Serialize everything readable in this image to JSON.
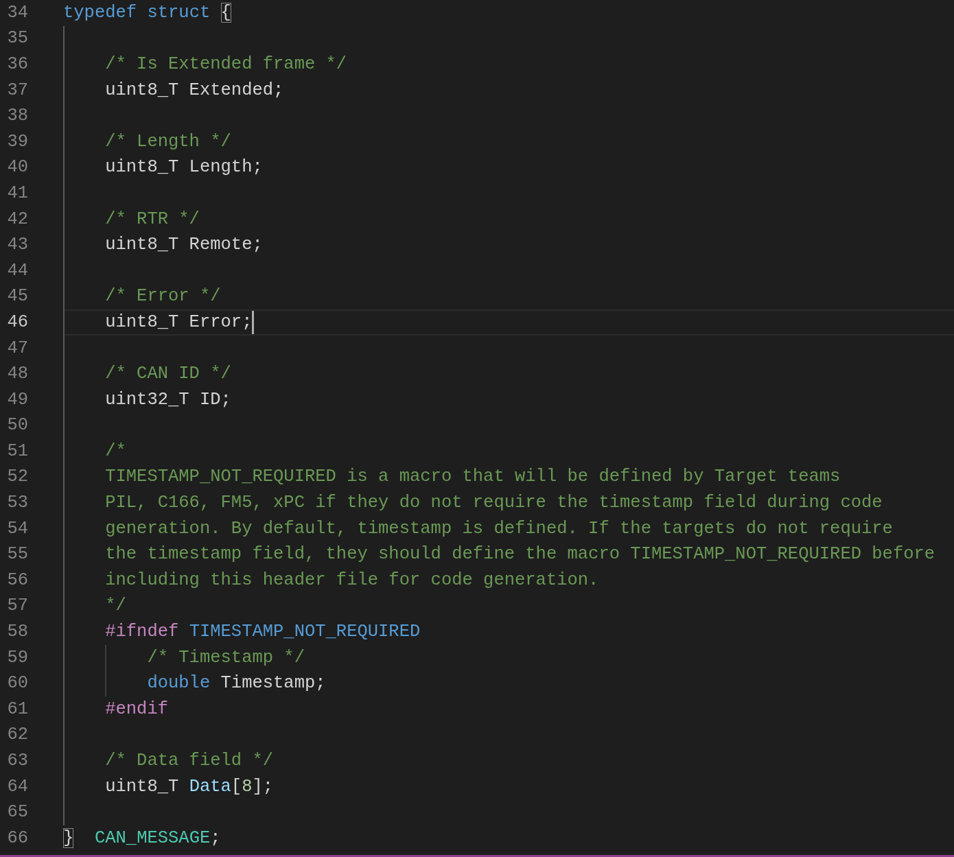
{
  "editor": {
    "lines": [
      {
        "number": "34",
        "current": false,
        "tokens": [
          {
            "text": "typedef struct ",
            "kind": "keyword"
          },
          {
            "text": "{",
            "kind": "bracket-match"
          }
        ],
        "children": [
          {
            "number": "35",
            "current": false
          },
          {
            "number": "36",
            "current": false,
            "tokens": [
              {
                "text": "/* Is Extended frame */",
                "kind": "comment"
              }
            ]
          },
          {
            "number": "37",
            "current": false,
            "tokens": [
              {
                "text": "uint8_T Extended;",
                "kind": "text"
              }
            ]
          },
          {
            "number": "38",
            "current": false
          },
          {
            "number": "39",
            "current": false,
            "tokens": [
              {
                "text": "/* Length */",
                "kind": "comment"
              }
            ]
          },
          {
            "number": "40",
            "current": false,
            "tokens": [
              {
                "text": "uint8_T Length;",
                "kind": "text"
              }
            ]
          },
          {
            "number": "41",
            "current": false
          },
          {
            "number": "42",
            "current": false,
            "tokens": [
              {
                "text": "/* RTR */",
                "kind": "comment"
              }
            ]
          },
          {
            "number": "43",
            "current": false,
            "tokens": [
              {
                "text": "uint8_T Remote;",
                "kind": "text"
              }
            ]
          },
          {
            "number": "44",
            "current": false
          },
          {
            "number": "45",
            "current": false,
            "tokens": [
              {
                "text": "/* Error */",
                "kind": "comment"
              }
            ]
          },
          {
            "number": "46",
            "current": true,
            "tokens": [
              {
                "text": "uint8_T Error;",
                "kind": "text"
              }
            ]
          },
          {
            "number": "47",
            "current": false
          },
          {
            "number": "48",
            "current": false,
            "tokens": [
              {
                "text": "/* CAN ID */",
                "kind": "comment"
              }
            ]
          },
          {
            "number": "49",
            "current": false,
            "tokens": [
              {
                "text": "uint32_T ID;",
                "kind": "text"
              }
            ]
          },
          {
            "number": "50",
            "current": false
          },
          {
            "number": "51",
            "current": false,
            "tokens": [
              {
                "text": "/*",
                "kind": "comment"
              }
            ]
          },
          {
            "number": "52",
            "current": false,
            "tokens": [
              {
                "text": "TIMESTAMP_NOT_REQUIRED is a macro that will be defined by Target teams",
                "kind": "comment"
              }
            ]
          },
          {
            "number": "53",
            "current": false,
            "tokens": [
              {
                "text": "PIL, C166, FM5, xPC if they do not require the timestamp field during code",
                "kind": "comment"
              }
            ]
          },
          {
            "number": "54",
            "current": false,
            "tokens": [
              {
                "text": "generation. By default, timestamp is defined. If the targets do not require",
                "kind": "comment"
              }
            ]
          },
          {
            "number": "55",
            "current": false,
            "tokens": [
              {
                "text": "the timestamp field, they should define the macro TIMESTAMP_NOT_REQUIRED before",
                "kind": "comment"
              }
            ]
          },
          {
            "number": "56",
            "current": false,
            "tokens": [
              {
                "text": "including this header file for code generation.",
                "kind": "comment"
              }
            ]
          },
          {
            "number": "57",
            "current": false,
            "tokens": [
              {
                "text": "*/",
                "kind": "comment"
              }
            ]
          },
          {
            "number": "58",
            "current": false,
            "tokens": [
              {
                "text": "#ifndef ",
                "kind": "preprocessor"
              },
              {
                "text": "TIMESTAMP_NOT_REQUIRED",
                "kind": "macro"
              }
            ],
            "children": [
              {
                "number": "59",
                "current": false,
                "tokens": [
                  {
                    "text": "/* Timestamp */",
                    "kind": "comment"
                  }
                ]
              },
              {
                "number": "60",
                "current": false,
                "tokens": [
                  {
                    "text": "double ",
                    "kind": "keyword"
                  },
                  {
                    "text": "Timestamp;",
                    "kind": "text"
                  }
                ]
              }
            ]
          },
          {
            "number": "61",
            "current": false,
            "tokens": [
              {
                "text": "#endif",
                "kind": "preprocessor"
              }
            ]
          },
          {
            "number": "62",
            "current": false
          },
          {
            "number": "63",
            "current": false,
            "tokens": [
              {
                "text": "/* Data field */",
                "kind": "comment"
              }
            ]
          },
          {
            "number": "64",
            "current": false,
            "tokens": [
              {
                "text": "uint8_T ",
                "kind": "text"
              },
              {
                "text": "Data",
                "kind": "variable"
              },
              {
                "text": "[",
                "kind": "text"
              },
              {
                "text": "8",
                "kind": "number"
              },
              {
                "text": "];",
                "kind": "text"
              }
            ]
          },
          {
            "number": "65",
            "current": false
          }
        ]
      },
      {
        "number": "66",
        "current": false,
        "tokens": [
          {
            "text": "}",
            "kind": "bracket-match"
          },
          {
            "text": "  CAN_MESSAGE",
            "kind": "type"
          },
          {
            "text": ";",
            "kind": "text"
          }
        ]
      }
    ]
  }
}
